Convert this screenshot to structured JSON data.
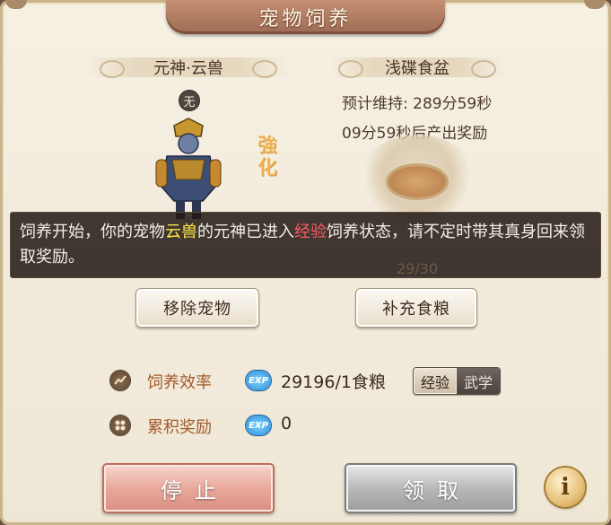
{
  "window": {
    "title": "宠物饲养"
  },
  "pet": {
    "name": "元神·云兽",
    "badge": "无",
    "strength_mark": "強化"
  },
  "food": {
    "name": "浅碟食盆",
    "duration": "预计维持: 289分59秒",
    "reward_timer": "09分59秒后产出奖励",
    "stock": "29/30"
  },
  "tooltip": {
    "part1": "饲养开始，你的宠物",
    "pet": "云兽",
    "part2": "的元神已进入",
    "mode": "经验",
    "part3": "饲养状态，请不定时带其真身回来领取奖励。"
  },
  "buttons": {
    "remove_pet": "移除宠物",
    "add_food": "补充食粮",
    "stop": "停止",
    "claim": "领取",
    "info": "i"
  },
  "efficiency": {
    "label": "饲养效率",
    "exp_icon": "EXP",
    "value": "29196/1食粮",
    "mode_options": [
      "经验",
      "武学"
    ],
    "selected_mode": "经验"
  },
  "accumulated": {
    "label": "累积奖励",
    "exp_icon": "EXP",
    "value": "0"
  },
  "colors": {
    "title_bar": "#b07b62",
    "label_orange": "#a45a2c",
    "highlight_yellow": "#ffe34a",
    "highlight_red": "#ff5868",
    "stop_button": "#e9a99b",
    "claim_button": "#b5b5b5"
  },
  "icons": [
    "trend-icon",
    "reward-icon",
    "exp-icon",
    "info-icon",
    "food-bowl-icon",
    "pet-figure"
  ]
}
